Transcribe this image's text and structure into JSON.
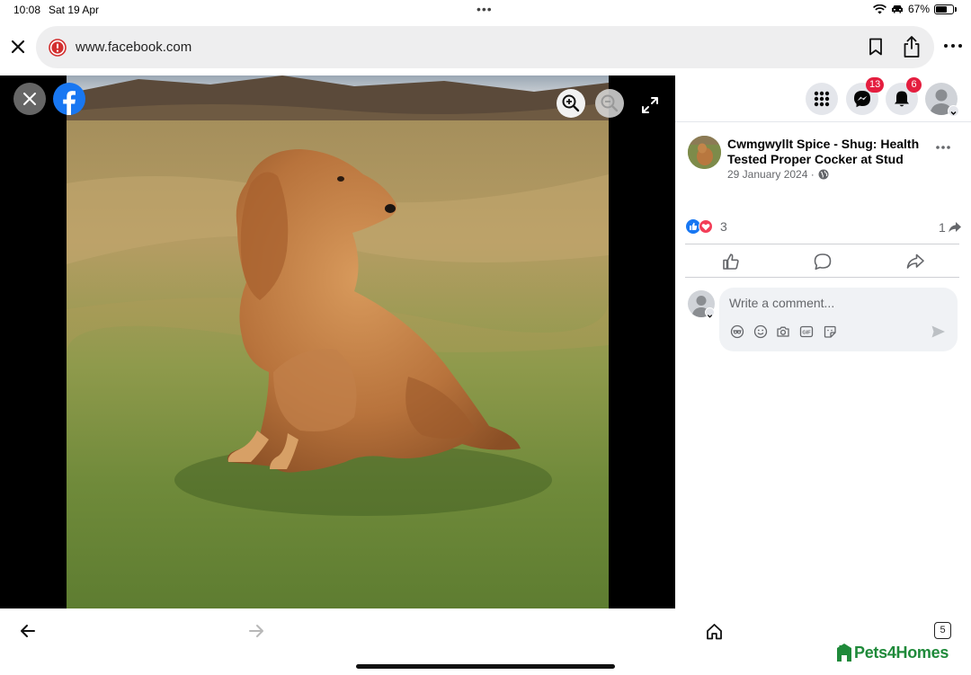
{
  "status_bar": {
    "time": "10:08",
    "date": "Sat 19 Apr",
    "battery": "67%",
    "battery_level": 0.67
  },
  "browser": {
    "url": "www.facebook.com",
    "open_tabs": "5"
  },
  "viewer": {
    "photo_subject": "golden cocker spaniel sitting on grass",
    "icons": [
      "close-icon",
      "facebook-logo",
      "zoom-in-icon",
      "zoom-out-icon",
      "fullscreen-icon"
    ]
  },
  "header": {
    "messenger_badge": "13",
    "notifications_badge": "6"
  },
  "post": {
    "page_name": "Cwmgwyllt Spice - Shug: Health Tested Proper Cocker at Stud",
    "date": "29 January 2024 ·",
    "reaction_count": "3",
    "share_count": "1"
  },
  "comment": {
    "placeholder": "Write a comment..."
  },
  "watermark": {
    "text": "Pets4Homes"
  },
  "colors": {
    "facebook_blue": "#1877f2",
    "badge_red": "#e41e3f",
    "love_red": "#f33e58",
    "watermark_green": "#1f8a3a"
  }
}
